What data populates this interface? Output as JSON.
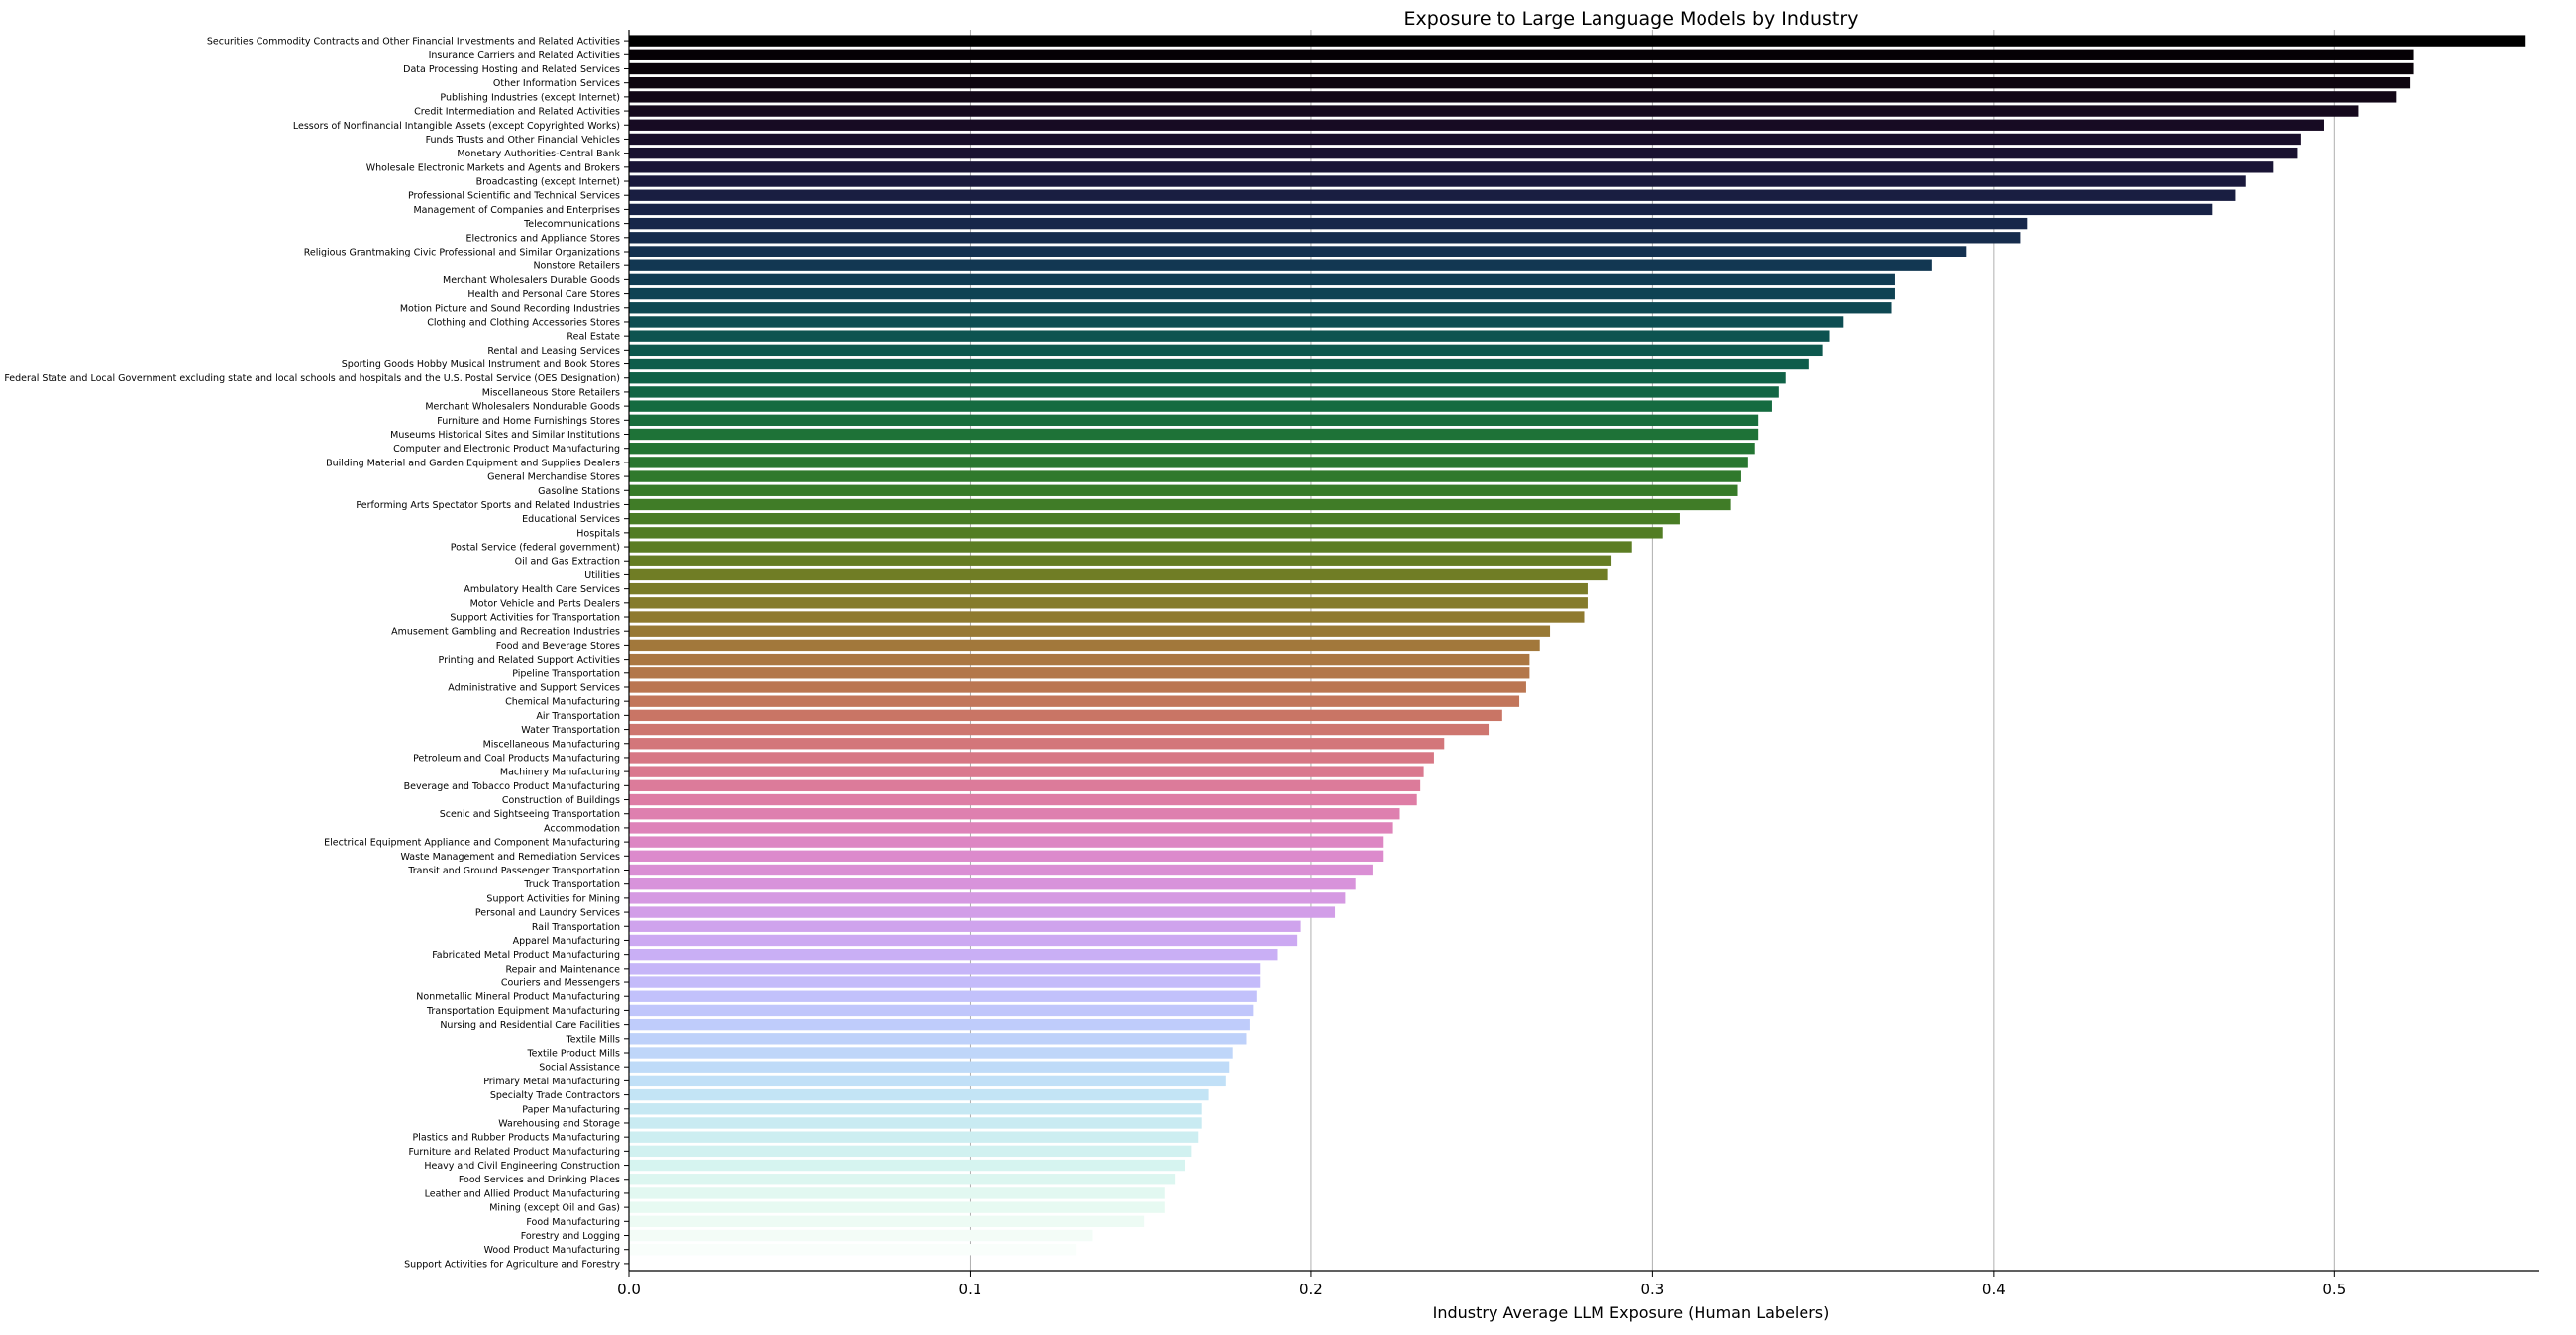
{
  "chart_data": {
    "type": "bar",
    "orientation": "horizontal",
    "title": "Exposure to Large Language Models by Industry",
    "xlabel": "Industry Average LLM Exposure (Human Labelers)",
    "ylabel": "",
    "xlim": [
      0.0,
      0.56
    ],
    "xticks": [
      "0.0",
      "0.1",
      "0.2",
      "0.3",
      "0.4",
      "0.5"
    ],
    "grid": "vertical x-grid lines",
    "colormap": "cubehelix (dark to light)",
    "categories": [
      "Securities Commodity Contracts and Other Financial Investments and Related Activities",
      "Insurance Carriers and Related Activities",
      "Data Processing Hosting and Related Services",
      "Other Information Services",
      "Publishing Industries (except Internet)",
      "Credit Intermediation and Related Activities",
      "Lessors of Nonfinancial Intangible Assets (except Copyrighted Works)",
      "Funds Trusts and Other Financial Vehicles",
      "Monetary Authorities-Central Bank",
      "Wholesale Electronic Markets and Agents and Brokers",
      "Broadcasting (except Internet)",
      "Professional Scientific and Technical Services",
      "Management of Companies and Enterprises",
      "Telecommunications",
      "Electronics and Appliance Stores",
      "Religious Grantmaking Civic Professional and Similar Organizations",
      "Nonstore Retailers",
      "Merchant Wholesalers Durable Goods",
      "Health and Personal Care Stores",
      "Motion Picture and Sound Recording Industries",
      "Clothing and Clothing Accessories Stores",
      "Real Estate",
      "Rental and Leasing Services",
      "Sporting Goods Hobby Musical Instrument and Book Stores",
      "Federal State and Local Government excluding state and local schools and hospitals and the U.S. Postal Service (OES Designation)",
      "Miscellaneous Store Retailers",
      "Merchant Wholesalers Nondurable Goods",
      "Furniture and Home Furnishings Stores",
      "Museums Historical Sites and Similar Institutions",
      "Computer and Electronic Product Manufacturing",
      "Building Material and Garden Equipment and Supplies Dealers",
      "General Merchandise Stores",
      "Gasoline Stations",
      "Performing Arts Spectator Sports and Related Industries",
      "Educational Services",
      "Hospitals",
      "Postal Service (federal government)",
      "Oil and Gas Extraction",
      "Utilities",
      "Ambulatory Health Care Services",
      "Motor Vehicle and Parts Dealers",
      "Support Activities for Transportation",
      "Amusement Gambling and Recreation Industries",
      "Food and Beverage Stores",
      "Printing and Related Support Activities",
      "Pipeline Transportation",
      "Administrative and Support Services",
      "Chemical Manufacturing",
      "Air Transportation",
      "Water Transportation",
      "Miscellaneous Manufacturing",
      "Petroleum and Coal Products Manufacturing",
      "Machinery Manufacturing",
      "Beverage and Tobacco Product Manufacturing",
      "Construction of Buildings",
      "Scenic and Sightseeing Transportation",
      "Accommodation",
      "Electrical Equipment Appliance and Component Manufacturing",
      "Waste Management and Remediation Services",
      "Transit and Ground Passenger Transportation",
      "Truck Transportation",
      "Support Activities for Mining",
      "Personal and Laundry Services",
      "Rail Transportation",
      "Apparel Manufacturing",
      "Fabricated Metal Product Manufacturing",
      "Repair and Maintenance",
      "Couriers and Messengers",
      "Nonmetallic Mineral Product Manufacturing",
      "Transportation Equipment Manufacturing",
      "Nursing and Residential Care Facilities",
      "Textile Mills",
      "Textile Product Mills",
      "Social Assistance",
      "Primary Metal Manufacturing",
      "Specialty Trade Contractors",
      "Paper Manufacturing",
      "Warehousing and Storage",
      "Plastics and Rubber Products Manufacturing",
      "Furniture and Related Product Manufacturing",
      "Heavy and Civil Engineering Construction",
      "Food Services and Drinking Places",
      "Leather and Allied Product Manufacturing",
      "Mining (except Oil and Gas)",
      "Food Manufacturing",
      "Forestry and Logging",
      "Wood Product Manufacturing",
      "Support Activities for Agriculture and Forestry"
    ],
    "values": [
      0.556,
      0.523,
      0.523,
      0.522,
      0.518,
      0.507,
      0.497,
      0.49,
      0.489,
      0.482,
      0.474,
      0.471,
      0.464,
      0.41,
      0.408,
      0.392,
      0.382,
      0.371,
      0.371,
      0.37,
      0.356,
      0.352,
      0.35,
      0.346,
      0.339,
      0.337,
      0.335,
      0.331,
      0.331,
      0.33,
      0.328,
      0.326,
      0.325,
      0.323,
      0.308,
      0.303,
      0.294,
      0.288,
      0.287,
      0.281,
      0.281,
      0.28,
      0.27,
      0.267,
      0.264,
      0.264,
      0.263,
      0.261,
      0.256,
      0.252,
      0.239,
      0.236,
      0.233,
      0.232,
      0.231,
      0.226,
      0.224,
      0.221,
      0.221,
      0.218,
      0.213,
      0.21,
      0.207,
      0.197,
      0.196,
      0.19,
      0.185,
      0.185,
      0.184,
      0.183,
      0.182,
      0.181,
      0.177,
      0.176,
      0.175,
      0.17,
      0.168,
      0.168,
      0.167,
      0.165,
      0.163,
      0.16,
      0.157,
      0.157,
      0.151,
      0.136,
      0.131,
      0.0
    ]
  }
}
